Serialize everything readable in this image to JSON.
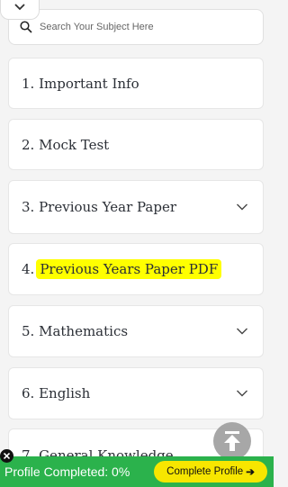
{
  "search": {
    "placeholder": "Search Your Subject Here"
  },
  "items": [
    {
      "label": "1. Important Info",
      "expandable": false
    },
    {
      "label": "2. Mock Test",
      "expandable": false
    },
    {
      "label": "3. Previous Year Paper",
      "expandable": true
    },
    {
      "number": "4.",
      "label": "Previous Years Paper PDF",
      "expandable": false,
      "highlight_color": "#ffff00"
    },
    {
      "label": "5. Mathematics",
      "expandable": true
    },
    {
      "label": "6. English",
      "expandable": true
    },
    {
      "label": "7. General Knowledge",
      "expandable": true
    }
  ],
  "profile_bar": {
    "progress_text": "Profile Completed: 0%",
    "progress_value": 0,
    "cta_label": "Complete Profile",
    "cta_arrow": "➔",
    "background": "#2bb24c",
    "cta_color": "#f7e600"
  },
  "icons": {
    "collapse": "chevron-down-icon",
    "search": "search-icon",
    "scroll_top": "arrow-up-icon",
    "close": "close-icon"
  }
}
